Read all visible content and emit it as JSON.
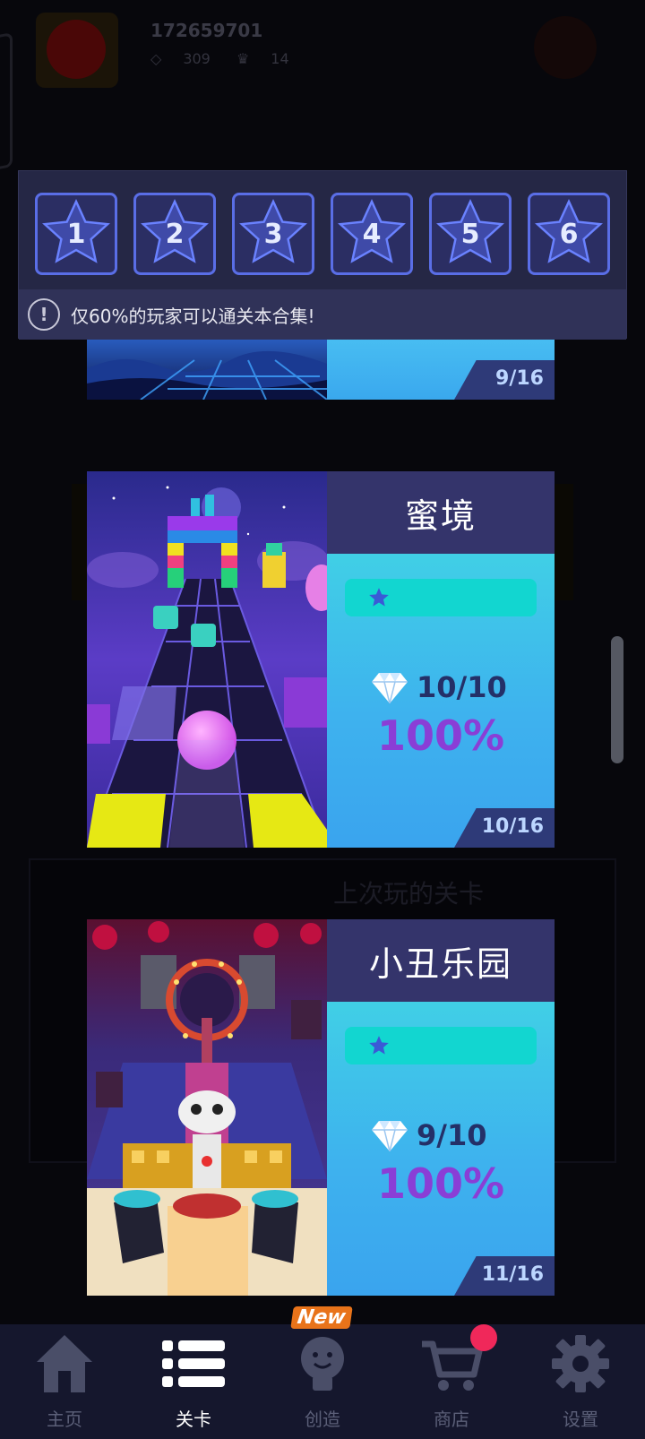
{
  "background": {
    "user_id": "172659701",
    "gems": "309",
    "crowns": "14",
    "last_played_label": "上次玩的关卡"
  },
  "star_tabs": [
    {
      "number": "1"
    },
    {
      "number": "2"
    },
    {
      "number": "3"
    },
    {
      "number": "4"
    },
    {
      "number": "5"
    },
    {
      "number": "6"
    }
  ],
  "hint": {
    "icon": "exclamation-icon",
    "text": "仅60%的玩家可以通关本合集!"
  },
  "levels": [
    {
      "title": "",
      "gems": "",
      "percent": "",
      "progress": "9/16"
    },
    {
      "title": "蜜境",
      "gems": "10/10",
      "percent": "100%",
      "progress": "10/16"
    },
    {
      "title": "小丑乐园",
      "gems": "9/10",
      "percent": "100%",
      "progress": "11/16"
    }
  ],
  "nav": {
    "items": [
      {
        "label": "主页",
        "icon": "home-icon"
      },
      {
        "label": "关卡",
        "icon": "list-icon"
      },
      {
        "label": "创造",
        "icon": "lightbulb-icon"
      },
      {
        "label": "商店",
        "icon": "cart-icon"
      },
      {
        "label": "设置",
        "icon": "gear-icon"
      }
    ],
    "new_badge": "New",
    "active_index": 1
  },
  "colors": {
    "accent_purple": "#8a3ed6",
    "info_blue": "#3aa8ee",
    "star_bar": "#12d6d0",
    "title_band": "#34346b"
  }
}
